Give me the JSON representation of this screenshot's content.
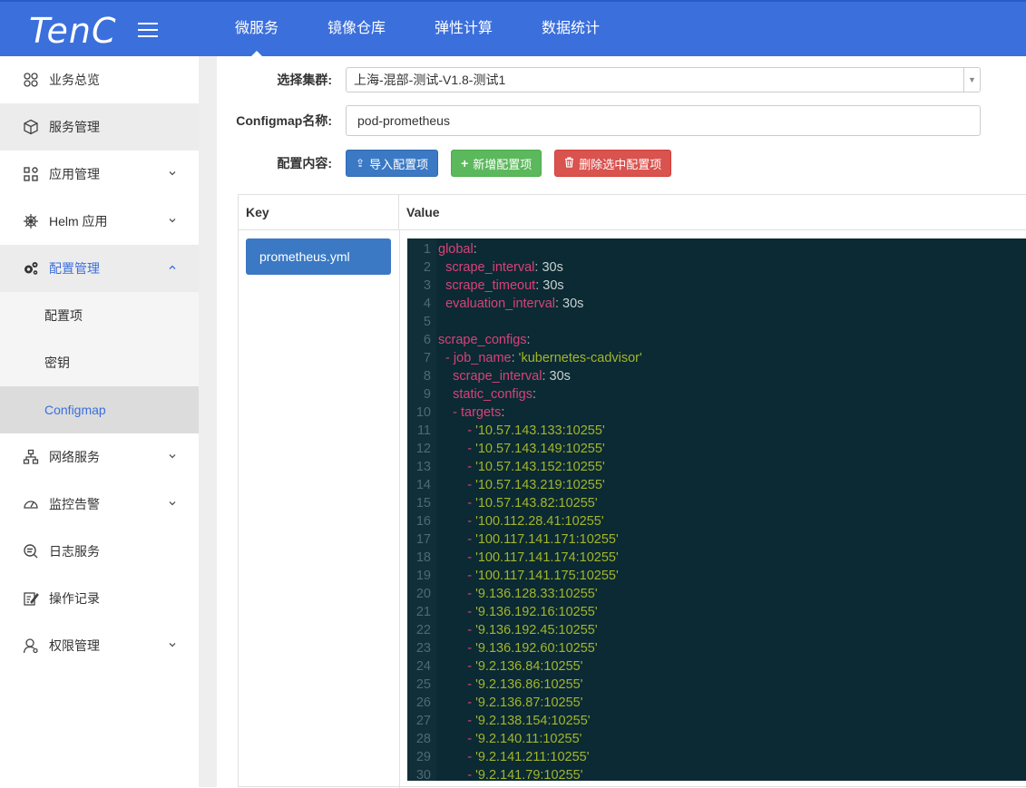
{
  "app": {
    "logo": "TenC"
  },
  "topnav": [
    {
      "label": "微服务",
      "active": true
    },
    {
      "label": "镜像仓库",
      "active": false
    },
    {
      "label": "弹性计算",
      "active": false
    },
    {
      "label": "数据统计",
      "active": false
    }
  ],
  "sidebar": {
    "items": [
      {
        "label": "业务总览",
        "icon": "grid-icon"
      },
      {
        "label": "服务管理",
        "icon": "cube-icon"
      },
      {
        "label": "应用管理",
        "icon": "apps-icon"
      },
      {
        "label": "Helm 应用",
        "icon": "helm-icon"
      },
      {
        "label": "配置管理",
        "icon": "gears-icon"
      },
      {
        "label": "配置项"
      },
      {
        "label": "密钥"
      },
      {
        "label": "Configmap"
      },
      {
        "label": "网络服务",
        "icon": "network-icon"
      },
      {
        "label": "监控告警",
        "icon": "gauge-icon"
      },
      {
        "label": "日志服务",
        "icon": "log-search-icon"
      },
      {
        "label": "操作记录",
        "icon": "edit-record-icon"
      },
      {
        "label": "权限管理",
        "icon": "user-permission-icon"
      }
    ]
  },
  "form": {
    "cluster_label": "选择集群:",
    "cluster_value": "上海-混部-测试-V1.8-测试1",
    "name_label": "Configmap名称:",
    "name_value": "pod-prometheus",
    "content_label": "配置内容:",
    "import_btn": "导入配置项",
    "add_btn": "新增配置项",
    "delete_btn": "删除选中配置项"
  },
  "table": {
    "key_header": "Key",
    "value_header": "Value",
    "key_item": "prometheus.yml"
  },
  "editor": {
    "lines": [
      {
        "n": "1",
        "indent": "",
        "key": "global",
        "val": "",
        "type": "k"
      },
      {
        "n": "2",
        "indent": "  ",
        "key": "scrape_interval",
        "val": "30s",
        "type": "kv"
      },
      {
        "n": "3",
        "indent": "  ",
        "key": "scrape_timeout",
        "val": "30s",
        "type": "kv"
      },
      {
        "n": "4",
        "indent": "  ",
        "key": "evaluation_interval",
        "val": "30s",
        "type": "kv"
      },
      {
        "n": "5",
        "indent": "",
        "key": "",
        "val": "",
        "type": "empty"
      },
      {
        "n": "6",
        "indent": "",
        "key": "scrape_configs",
        "val": "",
        "type": "k"
      },
      {
        "n": "7",
        "indent": "  - ",
        "key": "job_name",
        "val": "'kubernetes-cadvisor'",
        "type": "ks"
      },
      {
        "n": "8",
        "indent": "    ",
        "key": "scrape_interval",
        "val": "30s",
        "type": "kv"
      },
      {
        "n": "9",
        "indent": "    ",
        "key": "static_configs",
        "val": "",
        "type": "k"
      },
      {
        "n": "10",
        "indent": "    - ",
        "key": "targets",
        "val": "",
        "type": "k"
      },
      {
        "n": "11",
        "indent": "        - ",
        "key": "",
        "val": "'10.57.143.133:10255'",
        "type": "s"
      },
      {
        "n": "12",
        "indent": "        - ",
        "key": "",
        "val": "'10.57.143.149:10255'",
        "type": "s"
      },
      {
        "n": "13",
        "indent": "        - ",
        "key": "",
        "val": "'10.57.143.152:10255'",
        "type": "s"
      },
      {
        "n": "14",
        "indent": "        - ",
        "key": "",
        "val": "'10.57.143.219:10255'",
        "type": "s"
      },
      {
        "n": "15",
        "indent": "        - ",
        "key": "",
        "val": "'10.57.143.82:10255'",
        "type": "s"
      },
      {
        "n": "16",
        "indent": "        - ",
        "key": "",
        "val": "'100.112.28.41:10255'",
        "type": "s"
      },
      {
        "n": "17",
        "indent": "        - ",
        "key": "",
        "val": "'100.117.141.171:10255'",
        "type": "s"
      },
      {
        "n": "18",
        "indent": "        - ",
        "key": "",
        "val": "'100.117.141.174:10255'",
        "type": "s"
      },
      {
        "n": "19",
        "indent": "        - ",
        "key": "",
        "val": "'100.117.141.175:10255'",
        "type": "s"
      },
      {
        "n": "20",
        "indent": "        - ",
        "key": "",
        "val": "'9.136.128.33:10255'",
        "type": "s"
      },
      {
        "n": "21",
        "indent": "        - ",
        "key": "",
        "val": "'9.136.192.16:10255'",
        "type": "s"
      },
      {
        "n": "22",
        "indent": "        - ",
        "key": "",
        "val": "'9.136.192.45:10255'",
        "type": "s"
      },
      {
        "n": "23",
        "indent": "        - ",
        "key": "",
        "val": "'9.136.192.60:10255'",
        "type": "s"
      },
      {
        "n": "24",
        "indent": "        - ",
        "key": "",
        "val": "'9.2.136.84:10255'",
        "type": "s"
      },
      {
        "n": "25",
        "indent": "        - ",
        "key": "",
        "val": "'9.2.136.86:10255'",
        "type": "s"
      },
      {
        "n": "26",
        "indent": "        - ",
        "key": "",
        "val": "'9.2.136.87:10255'",
        "type": "s"
      },
      {
        "n": "27",
        "indent": "        - ",
        "key": "",
        "val": "'9.2.138.154:10255'",
        "type": "s"
      },
      {
        "n": "28",
        "indent": "        - ",
        "key": "",
        "val": "'9.2.140.11:10255'",
        "type": "s"
      },
      {
        "n": "29",
        "indent": "        - ",
        "key": "",
        "val": "'9.2.141.211:10255'",
        "type": "s"
      },
      {
        "n": "30",
        "indent": "        - ",
        "key": "",
        "val": "'9.2.141.79:10255'",
        "type": "s"
      }
    ]
  },
  "colors": {
    "primary": "#3b6fdc",
    "button_blue": "#3b79c4",
    "green": "#5cb85c",
    "red": "#d9534f",
    "editor_bg": "#0b2a33"
  }
}
